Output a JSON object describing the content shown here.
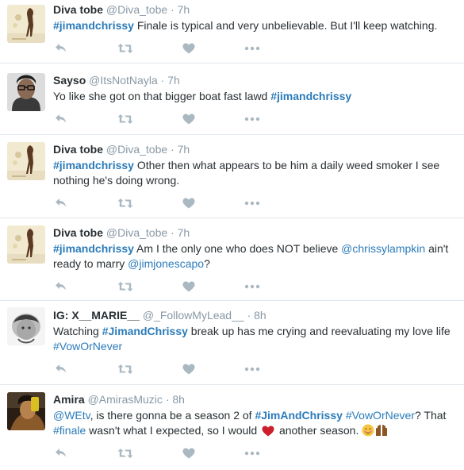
{
  "colors": {
    "link": "#2b7bb9",
    "meta": "#8899a6",
    "text": "#292f33",
    "action_icon": "#aab8c2",
    "divider": "#e1e8ed",
    "heart_emoji": "#cc1e2b"
  },
  "action_icons": [
    "reply-icon",
    "retweet-icon",
    "like-icon",
    "more-icon"
  ],
  "tweets": [
    {
      "name": "Diva tobe",
      "handle": "@Diva_tobe",
      "sep": "·",
      "time": "7h",
      "text": {
        "t0": "#jimandchrissy",
        "t1": "  Finale is typical and very unbelievable. But I'll keep watching."
      }
    },
    {
      "name": "Sayso",
      "handle": "@ItsNotNayla",
      "sep": "·",
      "time": "7h",
      "text": {
        "t0": "Yo like she got on that bigger boat fast lawd ",
        "t1": "#jimandchrissy"
      }
    },
    {
      "name": "Diva tobe",
      "handle": "@Diva_tobe",
      "sep": "·",
      "time": "7h",
      "text": {
        "t0": "#jimandchrissy",
        "t1": " Other then what appears to be him a daily weed smoker I see nothing he's doing wrong."
      }
    },
    {
      "name": "Diva tobe",
      "handle": "@Diva_tobe",
      "sep": "·",
      "time": "7h",
      "text": {
        "t0": "#jimandchrissy",
        "t1": " Am I the only one who does NOT believe ",
        "t2": "@chrissylampkin",
        "t3": " ain't ready to marry ",
        "t4": "@jimjonescapo",
        "t5": "?"
      }
    },
    {
      "name": "IG: X__MARIE__",
      "handle": "@_FollowMyLead__",
      "sep": "·",
      "time": "8h",
      "text": {
        "t0": "Watching ",
        "t1": "#JimandChrissy",
        "t2": " break up has me crying and reevaluating my love life ",
        "t3": "#VowOrNever"
      }
    },
    {
      "name": "Amira",
      "handle": "@AmirasMuzic",
      "sep": "·",
      "time": "8h",
      "text": {
        "t0": "@WEtv",
        "t1": ", is there gonna be a season 2 of ",
        "t2": "#JimAndChrissy",
        "t3": " ",
        "t4": "#VowOrNever",
        "t5": "? That ",
        "t6": "#finale",
        "t7": " wasn't what I expected, so I would ",
        "t8": " another season. "
      }
    }
  ]
}
